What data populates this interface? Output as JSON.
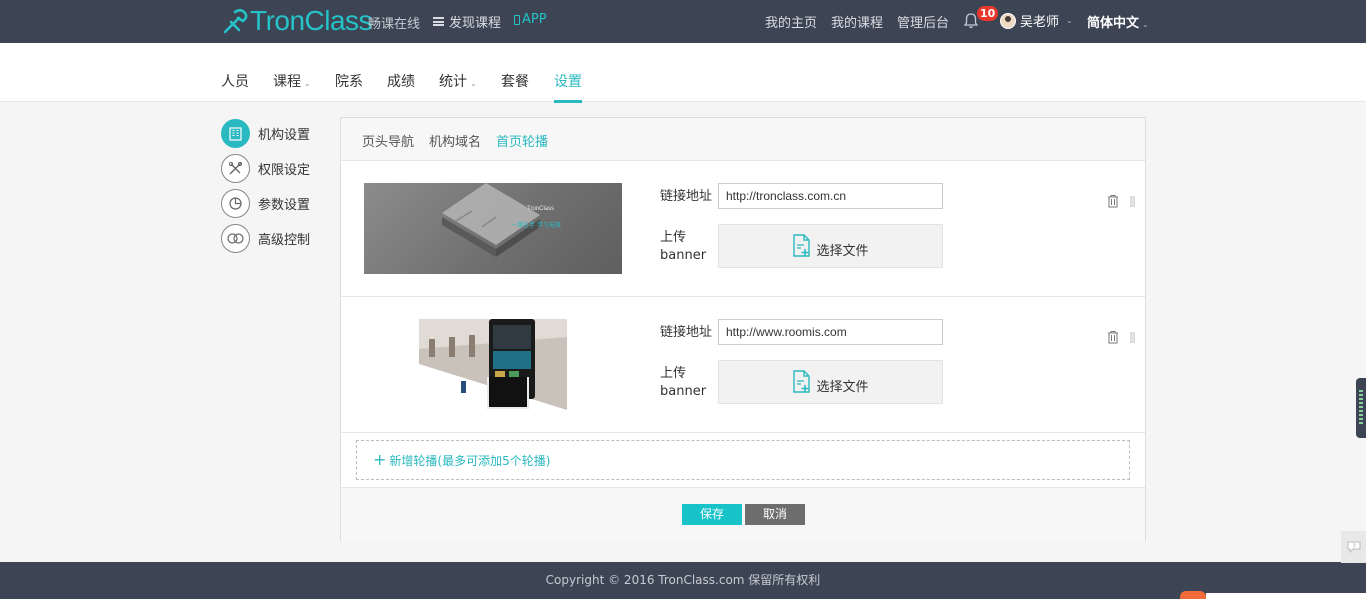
{
  "header": {
    "logo_text": "TronClass",
    "tagline": "畅课在线",
    "discover": "发现课程",
    "app": "APP",
    "my_home": "我的主页",
    "my_courses": "我的课程",
    "admin": "管理后台",
    "notification_count": "10",
    "user_name": "吴老师",
    "language": "简体中文"
  },
  "subnav": {
    "items": [
      {
        "label": "人员"
      },
      {
        "label": "课程"
      },
      {
        "label": "院系"
      },
      {
        "label": "成绩"
      },
      {
        "label": "统计"
      },
      {
        "label": "套餐"
      },
      {
        "label": "设置"
      }
    ],
    "active": "设置"
  },
  "sidebar": {
    "items": [
      {
        "label": "机构设置",
        "icon": "building-icon",
        "active": true
      },
      {
        "label": "权限设定",
        "icon": "tools-icon"
      },
      {
        "label": "参数设置",
        "icon": "pie-chart-icon"
      },
      {
        "label": "高级控制",
        "icon": "toggle-icon"
      }
    ]
  },
  "tabs": [
    {
      "label": "页头导航"
    },
    {
      "label": "机构域名"
    },
    {
      "label": "首页轮播",
      "active": true
    }
  ],
  "banners": [
    {
      "link_label": "链接地址",
      "link_value": "http://tronclass.com.cn",
      "upload_label": "上传banner",
      "upload_button": "选择文件",
      "image_text": "TronClass",
      "image_subtext": "一课在手 学习无限"
    },
    {
      "link_label": "链接地址",
      "link_value": "http://www.roomis.com",
      "upload_label": "上传banner",
      "upload_button": "选择文件"
    }
  ],
  "add_banner": "新增轮播(最多可添加5个轮播)",
  "buttons": {
    "save": "保存",
    "cancel": "取消"
  },
  "footer": "Copyright © 2016 TronClass.com 保留所有权利",
  "colors": {
    "accent": "#2ab9c0",
    "header_bg": "#3d4554",
    "badge": "#e8382b"
  }
}
